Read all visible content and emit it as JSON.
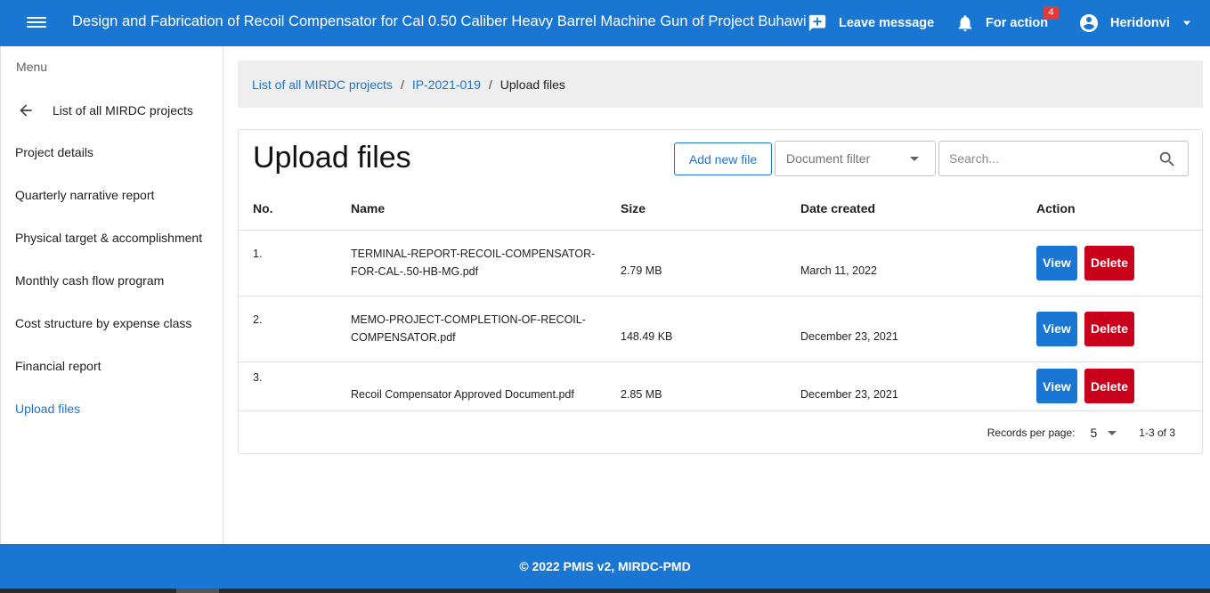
{
  "header": {
    "title": "Design and Fabrication of Recoil Compensator for Cal 0.50 Caliber Heavy Barrel Machine Gun of Project Buhawi",
    "leave_message": "Leave message",
    "for_action": "For action",
    "for_action_count": "4",
    "user_name": "Heridonvi",
    "bar_color": "#1976d2"
  },
  "sidebar": {
    "caption": "Menu",
    "back_label": "List of all MIRDC projects",
    "items": [
      {
        "label": "Project details"
      },
      {
        "label": "Quarterly narrative report"
      },
      {
        "label": "Physical target & accomplishment"
      },
      {
        "label": "Monthly cash flow program"
      },
      {
        "label": "Cost structure by expense class"
      },
      {
        "label": "Financial report"
      },
      {
        "label": "Upload files",
        "active": true
      }
    ]
  },
  "breadcrumb": {
    "items": [
      "List of all MIRDC projects",
      "IP-2021-019"
    ],
    "separator": "/",
    "current": "Upload files"
  },
  "main": {
    "title": "Upload files",
    "add_button": "Add new file",
    "filter_placeholder": "Document filter",
    "search_placeholder": "Search...",
    "columns": [
      "No.",
      "Name",
      "Size",
      "Date created",
      "Action"
    ],
    "rows": [
      {
        "no": "1.",
        "name_line1": "TERMINAL-REPORT-RECOIL-COMPENSATOR-",
        "name_line2": "FOR-CAL-.50-HB-MG.pdf",
        "size": "2.79 MB",
        "date": "March 11, 2022"
      },
      {
        "no": "2.",
        "name_line1": "MEMO-PROJECT-COMPLETION-OF-RECOIL-",
        "name_line2": "COMPENSATOR.pdf",
        "size": "148.49 KB",
        "date": "December 23, 2021"
      },
      {
        "no": "3.",
        "name_line1": "Recoil Compensator Approved Document.pdf",
        "name_line2": "",
        "size": "2.85 MB",
        "date": "December 23, 2021"
      }
    ],
    "view_label": "View",
    "delete_label": "Delete",
    "pager": {
      "records_label": "Records per page:",
      "per_page": "5",
      "range": "1-3 of 3"
    }
  },
  "footer": {
    "text": "© 2022 PMIS v2, MIRDC-PMD"
  }
}
